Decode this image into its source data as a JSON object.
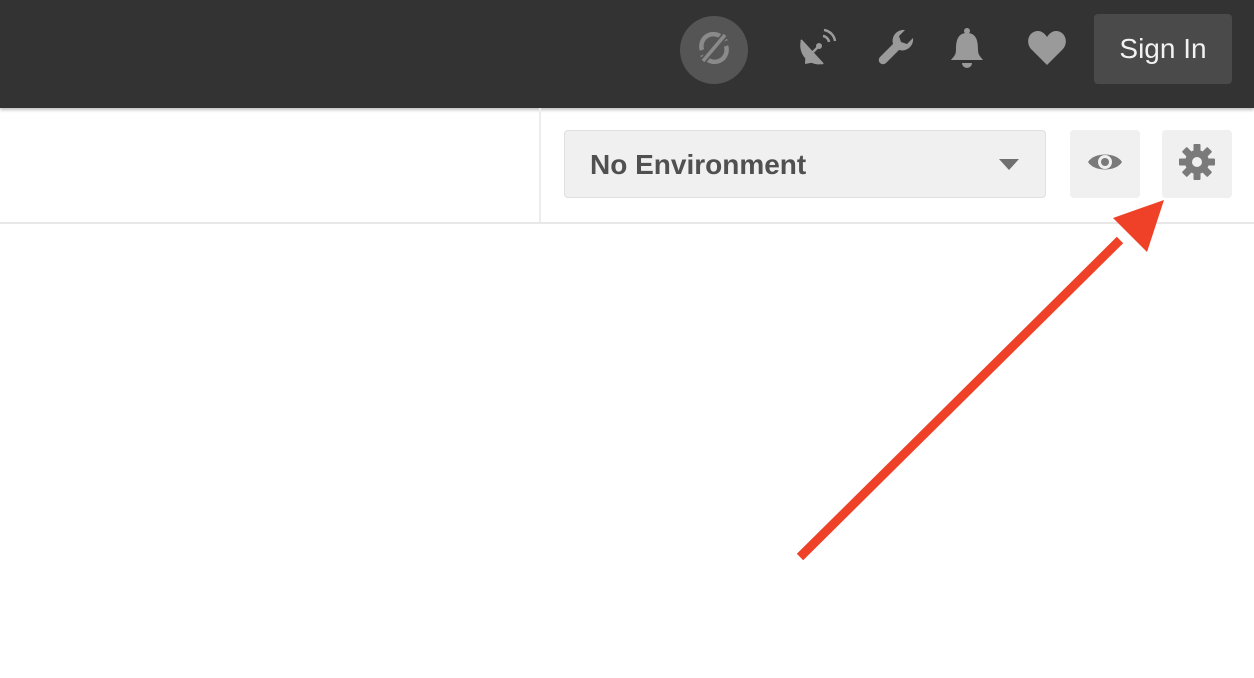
{
  "header": {
    "icons": {
      "sync": "sync-off-icon",
      "interceptor": "satellite-dish-icon",
      "settings": "wrench-icon",
      "notifications": "bell-icon",
      "favorite": "heart-icon"
    },
    "sign_in_label": "Sign In"
  },
  "environment": {
    "selected": "No Environment",
    "quick_look_icon": "eye-icon",
    "manage_icon": "gear-icon"
  },
  "annotation": {
    "arrow_color": "#ee4128",
    "points_to": "gear-icon"
  },
  "colors": {
    "topbar": "#333333",
    "button_bg": "#f0f0f0",
    "icon_gray": "#808080"
  }
}
